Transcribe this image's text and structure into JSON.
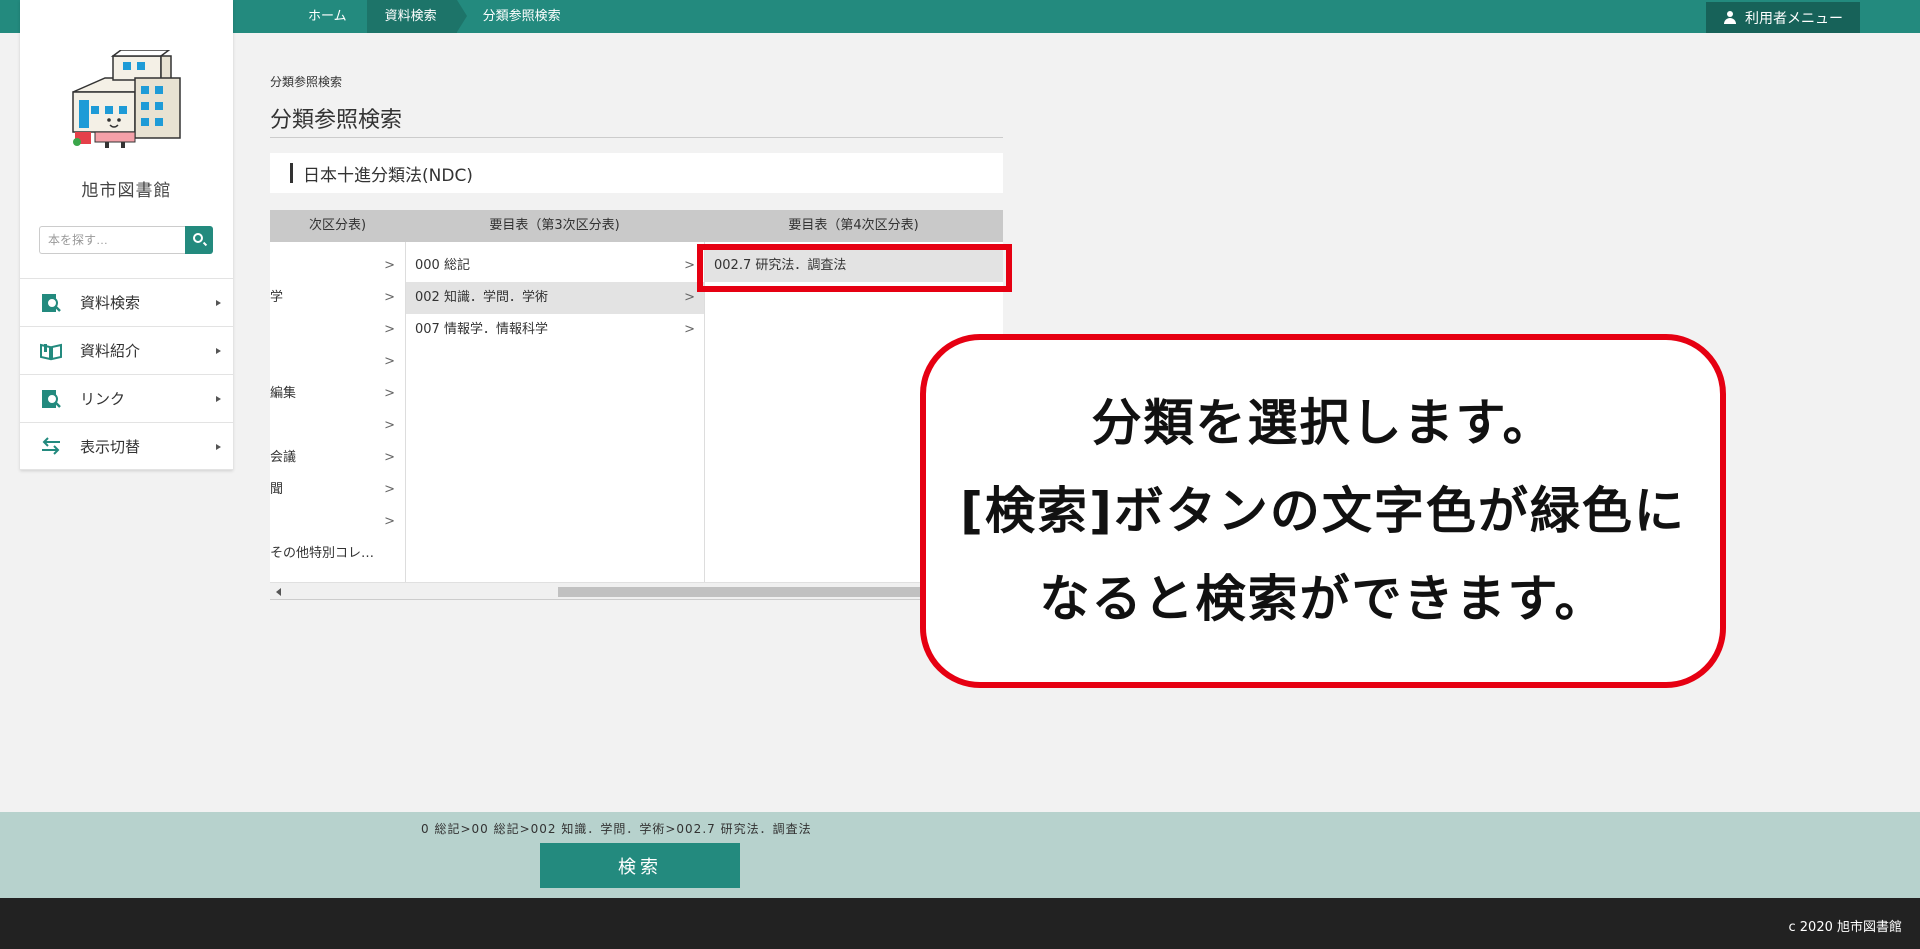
{
  "breadcrumb": [
    "ホーム",
    "資料検索",
    "分類参照検索"
  ],
  "user_menu": {
    "label": "利用者メニュー",
    "icon": "user-icon"
  },
  "sidebar": {
    "library_name": "旭市図書館",
    "search_placeholder": "本を探す…",
    "menu": [
      {
        "label": "資料検索",
        "icon": "book-search-icon"
      },
      {
        "label": "資料紹介",
        "icon": "open-book-icon"
      },
      {
        "label": "リンク",
        "icon": "link-search-icon"
      },
      {
        "label": "表示切替",
        "icon": "switch-arrows-icon"
      }
    ]
  },
  "main": {
    "small_title": "分類参照検索",
    "title": "分類参照検索",
    "ndc_header": "日本十進分類法(NDC)",
    "columns": [
      {
        "header": "次区分表)",
        "rows": [
          "",
          "学",
          "",
          "",
          "編集",
          "",
          "会議",
          "聞",
          "",
          "その他特別コレ…"
        ]
      },
      {
        "header": "要目表（第3次区分表)",
        "rows": [
          "000 総記",
          "002 知識．学問．学術",
          "007 情報学．情報科学"
        ]
      },
      {
        "header": "要目表（第4次区分表)",
        "rows": [
          "002.7 研究法．調査法"
        ]
      }
    ]
  },
  "callout": {
    "lines": [
      "分類を選択します。",
      "[検索]ボタンの文字色が緑色に",
      "なると検索ができます。"
    ]
  },
  "footer": {
    "path": "0 総記>00 総記>002 知識．学問．学術>002.7 研究法．調査法",
    "search_button": "検索",
    "copyright": "c 2020 旭市図書館"
  },
  "colors": {
    "primary": "#238a7e",
    "highlight": "#e60012",
    "footer": "#b7d2cd"
  }
}
